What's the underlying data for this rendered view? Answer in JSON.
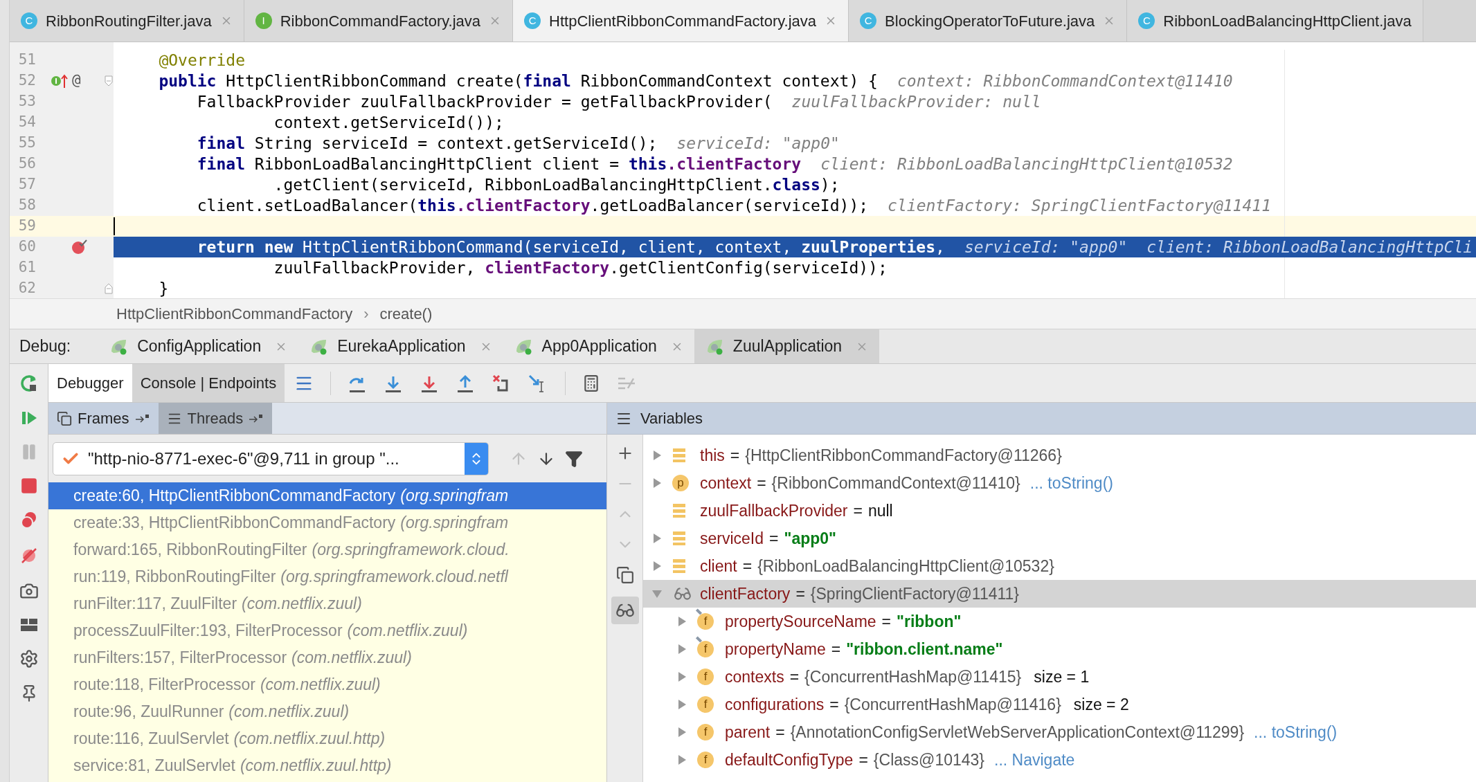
{
  "editor_tabs": [
    {
      "label": "RibbonRoutingFilter.java",
      "kind": "class",
      "icon_text": "C",
      "selected": false
    },
    {
      "label": "RibbonCommandFactory.java",
      "kind": "interface",
      "icon_text": "I",
      "selected": false
    },
    {
      "label": "HttpClientRibbonCommandFactory.java",
      "kind": "class",
      "icon_text": "C",
      "selected": true
    },
    {
      "label": "BlockingOperatorToFuture.java",
      "kind": "class",
      "icon_text": "C",
      "selected": false
    },
    {
      "label": "RibbonLoadBalancingHttpClient.java",
      "kind": "class",
      "icon_text": "C",
      "selected": false
    }
  ],
  "code": {
    "lines": [
      {
        "number": "51",
        "caret": false,
        "execution": false,
        "tokens": [
          {
            "kind": "annotation",
            "text": "    @Override"
          }
        ]
      },
      {
        "number": "52",
        "caret": false,
        "execution": false,
        "gutter_icons": [
          {
            "kind": "implements"
          }
        ],
        "gutter_text": "@",
        "fold": {
          "kind": "start"
        },
        "tokens": [
          {
            "kind": "kw",
            "text": "    public"
          },
          {
            "kind": "plain",
            "text": " HttpClientRibbonCommand create("
          },
          {
            "kind": "kw",
            "text": "final"
          },
          {
            "kind": "plain",
            "text": " RibbonCommandContext context) {"
          }
        ],
        "hints": [
          "context: RibbonCommandContext@11410"
        ]
      },
      {
        "number": "53",
        "caret": false,
        "execution": false,
        "tokens": [
          {
            "kind": "plain",
            "text": "        FallbackProvider zuulFallbackProvider = getFallbackProvider("
          }
        ],
        "hints": [
          "zuulFallbackProvider: null"
        ]
      },
      {
        "number": "54",
        "caret": false,
        "execution": false,
        "tokens": [
          {
            "kind": "plain",
            "text": "                context.getServiceId());"
          }
        ]
      },
      {
        "number": "55",
        "caret": false,
        "execution": false,
        "tokens": [
          {
            "kind": "kw",
            "text": "        final"
          },
          {
            "kind": "plain",
            "text": " String serviceId = context.getServiceId();"
          }
        ],
        "hints": [
          "serviceId: \"app0\""
        ]
      },
      {
        "number": "56",
        "caret": false,
        "execution": false,
        "tokens": [
          {
            "kind": "kw",
            "text": "        final"
          },
          {
            "kind": "plain",
            "text": " RibbonLoadBalancingHttpClient client = "
          },
          {
            "kind": "kw",
            "text": "this"
          },
          {
            "kind": "field",
            "text": ".clientFactory"
          }
        ],
        "hints": [
          "client: RibbonLoadBalancingHttpClient@10532"
        ]
      },
      {
        "number": "57",
        "caret": false,
        "execution": false,
        "tokens": [
          {
            "kind": "plain",
            "text": "                .getClient(serviceId, RibbonLoadBalancingHttpClient."
          },
          {
            "kind": "kw",
            "text": "class"
          },
          {
            "kind": "plain",
            "text": ");"
          }
        ]
      },
      {
        "number": "58",
        "caret": false,
        "execution": false,
        "tokens": [
          {
            "kind": "plain",
            "text": "        client.setLoadBalancer("
          },
          {
            "kind": "kw",
            "text": "this"
          },
          {
            "kind": "field",
            "text": ".clientFactory"
          },
          {
            "kind": "plain",
            "text": ".getLoadBalancer(serviceId));"
          }
        ],
        "hints": [
          "clientFactory: SpringClientFactory@11411"
        ]
      },
      {
        "number": "59",
        "caret": true,
        "execution": false
      },
      {
        "number": "60",
        "caret": false,
        "execution": true,
        "gutter_icons": [
          {
            "kind": "breakpoint"
          }
        ],
        "tokens": [
          {
            "kind": "kw",
            "text": "        return new"
          },
          {
            "kind": "plain",
            "text": " HttpClientRibbonCommand(serviceId, client, context, "
          },
          {
            "kind": "field",
            "text": "zuulProperties"
          },
          {
            "kind": "plain",
            "text": ","
          }
        ],
        "hints": [
          "serviceId: \"app0\"",
          "client: RibbonLoadBalancingHttpCli"
        ]
      },
      {
        "number": "61",
        "caret": false,
        "execution": false,
        "tokens": [
          {
            "kind": "plain",
            "text": "                zuulFallbackProvider, "
          },
          {
            "kind": "field",
            "text": "clientFactory"
          },
          {
            "kind": "plain",
            "text": ".getClientConfig(serviceId));"
          }
        ]
      },
      {
        "number": "62",
        "caret": false,
        "execution": false,
        "fold": {
          "kind": "end"
        },
        "tokens": [
          {
            "kind": "plain",
            "text": "    }"
          }
        ]
      }
    ]
  },
  "breadcrumb": {
    "items": [
      "HttpClientRibbonCommandFactory",
      "create()"
    ],
    "separator": "›"
  },
  "debug": {
    "label": "Debug:",
    "sessions": [
      {
        "label": "ConfigApplication",
        "selected": false
      },
      {
        "label": "EurekaApplication",
        "selected": false
      },
      {
        "label": "App0Application",
        "selected": false
      },
      {
        "label": "ZuulApplication",
        "selected": true
      }
    ],
    "tabs": [
      {
        "label": "Debugger",
        "selected": true
      },
      {
        "label": "Console | Endpoints",
        "selected": false
      }
    ]
  },
  "frames_panel": {
    "tabs": [
      {
        "label": "Frames",
        "selected": true
      },
      {
        "label": "Threads",
        "selected": false
      }
    ],
    "thread": "\"http-nio-8771-exec-6\"@9,711 in group \"...",
    "frames": [
      {
        "location": "create:60, HttpClientRibbonCommandFactory",
        "package": "(org.springfram",
        "selected": true
      },
      {
        "location": "create:33, HttpClientRibbonCommandFactory",
        "package": "(org.springfram",
        "selected": false
      },
      {
        "location": "forward:165, RibbonRoutingFilter",
        "package": "(org.springframework.cloud.",
        "selected": false
      },
      {
        "location": "run:119, RibbonRoutingFilter",
        "package": "(org.springframework.cloud.netfl",
        "selected": false
      },
      {
        "location": "runFilter:117, ZuulFilter",
        "package": "(com.netflix.zuul)",
        "selected": false
      },
      {
        "location": "processZuulFilter:193, FilterProcessor",
        "package": "(com.netflix.zuul)",
        "selected": false
      },
      {
        "location": "runFilters:157, FilterProcessor",
        "package": "(com.netflix.zuul)",
        "selected": false
      },
      {
        "location": "route:118, FilterProcessor",
        "package": "(com.netflix.zuul)",
        "selected": false
      },
      {
        "location": "route:96, ZuulRunner",
        "package": "(com.netflix.zuul)",
        "selected": false
      },
      {
        "location": "route:116, ZuulServlet",
        "package": "(com.netflix.zuul.http)",
        "selected": false
      },
      {
        "location": "service:81, ZuulServlet",
        "package": "(com.netflix.zuul.http)",
        "selected": false
      }
    ]
  },
  "variables_panel": {
    "title": "Variables",
    "variables": [
      {
        "kind": "local",
        "name": "this",
        "sep": "=",
        "value": {
          "kind": "object",
          "text": "{HttpClientRibbonCommandFactory@11266}"
        },
        "expandable": true,
        "expanded": false,
        "selected": false
      },
      {
        "kind": "param",
        "icon_text": "p",
        "name": "context",
        "sep": "=",
        "value": {
          "kind": "object",
          "text": "{RibbonCommandContext@11410}"
        },
        "link": "... toString()",
        "expandable": true,
        "expanded": false,
        "selected": false
      },
      {
        "kind": "local",
        "name": "zuulFallbackProvider",
        "sep": "=",
        "value": {
          "kind": "null",
          "text": "null"
        },
        "expandable": false,
        "expanded": false,
        "selected": false
      },
      {
        "kind": "local",
        "name": "serviceId",
        "sep": "=",
        "value": {
          "kind": "string",
          "text": "\"app0\""
        },
        "expandable": true,
        "expanded": false,
        "selected": false
      },
      {
        "kind": "local",
        "name": "client",
        "sep": "=",
        "value": {
          "kind": "object",
          "text": "{RibbonLoadBalancingHttpClient@10532}"
        },
        "expandable": true,
        "expanded": false,
        "selected": false
      },
      {
        "kind": "watch",
        "name": "clientFactory",
        "sep": "=",
        "value": {
          "kind": "object",
          "text": "{SpringClientFactory@11411}"
        },
        "expandable": true,
        "expanded": true,
        "selected": true,
        "children": [
          {
            "kind": "field",
            "icon_text": "f",
            "final": true,
            "name": "propertySourceName",
            "sep": "=",
            "value": {
              "kind": "string",
              "text": "\"ribbon\""
            },
            "expandable": true,
            "expanded": false,
            "selected": false
          },
          {
            "kind": "field",
            "icon_text": "f",
            "final": true,
            "name": "propertyName",
            "sep": "=",
            "value": {
              "kind": "string",
              "text": "\"ribbon.client.name\""
            },
            "expandable": true,
            "expanded": false,
            "selected": false
          },
          {
            "kind": "field",
            "icon_text": "f",
            "final": false,
            "name": "contexts",
            "sep": "=",
            "value": {
              "kind": "object",
              "text": "{ConcurrentHashMap@11415}"
            },
            "extra": "size = 1",
            "expandable": true,
            "expanded": false,
            "selected": false
          },
          {
            "kind": "field",
            "icon_text": "f",
            "final": false,
            "name": "configurations",
            "sep": "=",
            "value": {
              "kind": "object",
              "text": "{ConcurrentHashMap@11416}"
            },
            "extra": "size = 2",
            "expandable": true,
            "expanded": false,
            "selected": false
          },
          {
            "kind": "field",
            "icon_text": "f",
            "final": false,
            "name": "parent",
            "sep": "=",
            "value": {
              "kind": "object",
              "text": "{AnnotationConfigServletWebServerApplicationContext@11299}"
            },
            "link": "... toString()",
            "expandable": true,
            "expanded": false,
            "selected": false
          },
          {
            "kind": "field",
            "icon_text": "f",
            "final": false,
            "name": "defaultConfigType",
            "sep": "=",
            "value": {
              "kind": "object",
              "text": "{Class@10143}"
            },
            "link": "... Navigate",
            "expandable": true,
            "expanded": false,
            "selected": false
          }
        ]
      }
    ]
  }
}
